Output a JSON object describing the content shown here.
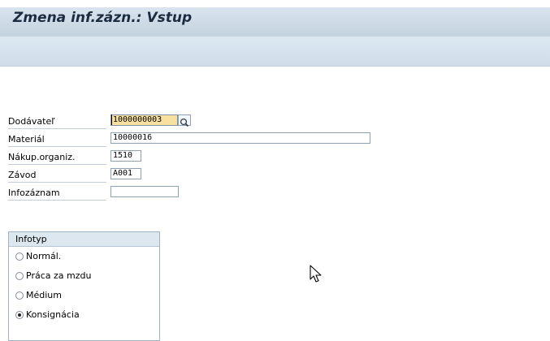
{
  "window": {
    "title": "Zmena inf.zázn.: Vstup"
  },
  "form": {
    "fields": [
      {
        "label": "Dodávateľ",
        "value": "1000000003"
      },
      {
        "label": "Materiál",
        "value": "10000016"
      },
      {
        "label": "Nákup.organiz.",
        "value": "1510"
      },
      {
        "label": "Závod",
        "value": "A001"
      },
      {
        "label": "Infozáznam",
        "value": ""
      }
    ]
  },
  "infotype": {
    "title": "Infotyp",
    "options": [
      {
        "label": "Normál.",
        "selected": false
      },
      {
        "label": "Práca za mzdu",
        "selected": false
      },
      {
        "label": "Médium",
        "selected": false
      },
      {
        "label": "Konsignácia",
        "selected": true
      }
    ]
  },
  "icons": {
    "value_help": "search-icon",
    "pointer": "mouse-cursor-icon"
  },
  "colors": {
    "title_bar": "#d4e1ec",
    "active_field": "#f7e0a0",
    "title_text": "#1c2c40"
  }
}
